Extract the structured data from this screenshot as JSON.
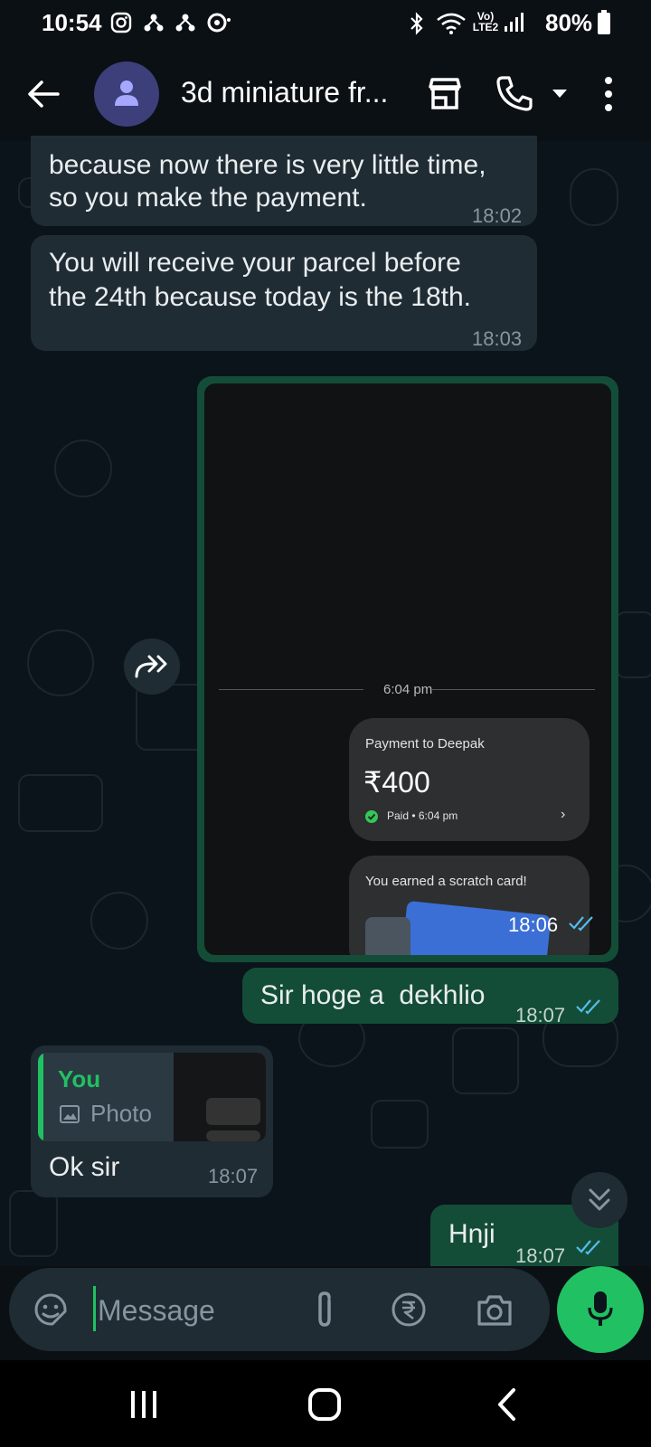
{
  "status_bar": {
    "time": "10:54",
    "network_label": "Vo) LTE2",
    "battery": "80%"
  },
  "header": {
    "title": "3d miniature fr..."
  },
  "messages": {
    "m1": {
      "text_line1": "because now there is very little time,",
      "text_line2": "so you make the payment.",
      "time": "18:02"
    },
    "m2": {
      "text_line1": "You will receive your parcel before",
      "text_line2": "the 24th because today is the 18th.",
      "time": "18:03"
    },
    "m3": {
      "time": "18:06",
      "screenshot": {
        "divider_time": "6:04 pm",
        "payment_title": "Payment to Deepak",
        "amount": "₹400",
        "status": "Paid • 6:04 pm",
        "scratch_text": "You earned a scratch card!"
      }
    },
    "m4": {
      "text": "Sir hoge a  dekhlio",
      "time": "18:07"
    },
    "m5": {
      "quote_author": "You",
      "quote_type": "Photo",
      "text": "Ok sir",
      "time": "18:07"
    },
    "m6": {
      "text": "Hnji",
      "time": "18:07"
    }
  },
  "input": {
    "placeholder": "Message"
  },
  "colors": {
    "accent": "#21c063",
    "outgoing_bubble": "#144d37",
    "incoming_bubble": "#202c33",
    "read_ticks": "#53bdeb"
  }
}
